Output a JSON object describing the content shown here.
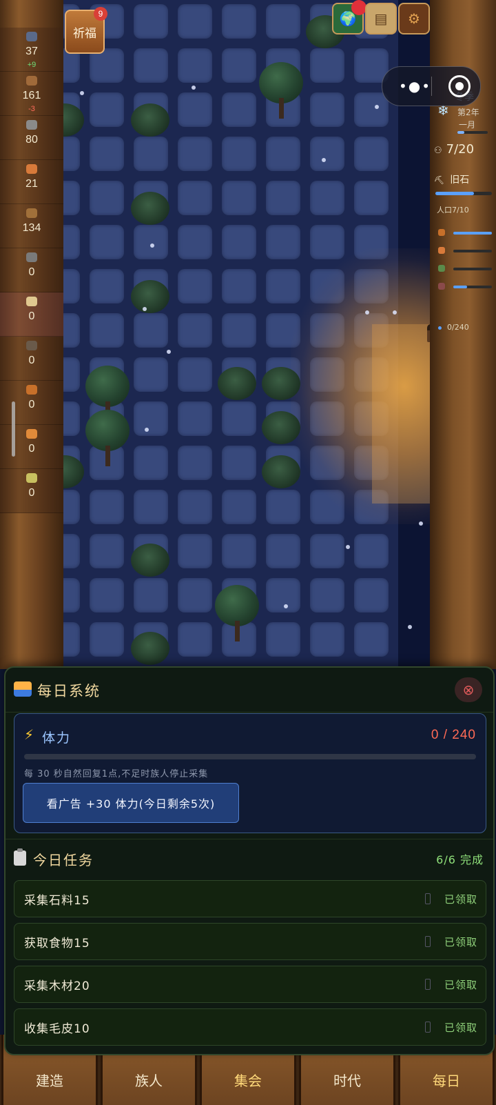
{
  "top": {
    "pray_label": "祈福",
    "pray_badge": "9"
  },
  "resources": [
    {
      "value": "37",
      "delta": "+9",
      "delta_type": "pos",
      "color": "#5a6a8a"
    },
    {
      "value": "161",
      "delta": "-3",
      "delta_type": "neg",
      "color": "#a06a3a"
    },
    {
      "value": "80",
      "delta": "",
      "delta_type": "",
      "color": "#8a8a8a"
    },
    {
      "value": "21",
      "delta": "",
      "delta_type": "",
      "color": "#d87a3a"
    },
    {
      "value": "134",
      "delta": "",
      "delta_type": "",
      "color": "#a0703a"
    },
    {
      "value": "0",
      "delta": "",
      "delta_type": "",
      "color": "#7a7a7a"
    },
    {
      "value": "0",
      "delta": "",
      "delta_type": "",
      "color": "#e0c890"
    },
    {
      "value": "0",
      "delta": "",
      "delta_type": "",
      "color": "#6a5a4a"
    },
    {
      "value": "0",
      "delta": "",
      "delta_type": "",
      "color": "#c8702a"
    },
    {
      "value": "0",
      "delta": "",
      "delta_type": "",
      "color": "#e08a3a"
    },
    {
      "value": "0",
      "delta": "",
      "delta_type": "",
      "color": "#c8c060"
    }
  ],
  "season": {
    "name": "冬季",
    "year": "第2年",
    "month": "一月",
    "progress": 0.22
  },
  "population": {
    "value": "7/20"
  },
  "era": {
    "name": "旧石",
    "progress": 0.68,
    "pop_cap": "人口7/10"
  },
  "mini_bars": [
    {
      "color": "#c8702a",
      "progress": 1.0
    },
    {
      "color": "#d87a3a",
      "progress": 0.0
    },
    {
      "color": "#5a8a4a",
      "progress": 0.0
    },
    {
      "color": "#8a4a4a",
      "progress": 0.35
    }
  ],
  "mini_stamina": "0/240",
  "nav": [
    {
      "label": "建造"
    },
    {
      "label": "族人"
    },
    {
      "label": "集会"
    },
    {
      "label": "时代"
    },
    {
      "label": "每日"
    }
  ],
  "daily": {
    "title": "每日系统",
    "close_icon": "⊗",
    "stamina": {
      "label": "体力",
      "value": "0 / 240",
      "current": 0,
      "max": 240,
      "hint": "每 30 秒自然回复1点,不足时族人停止采集",
      "ad_button": "看广告 +30 体力(今日剩余5次)"
    },
    "tasks_title": "今日任务",
    "tasks_count": "6/6 完成",
    "tasks": [
      {
        "name": "采集石料15",
        "state": "已领取"
      },
      {
        "name": "获取食物15",
        "state": "已领取"
      },
      {
        "name": "采集木材20",
        "state": "已领取"
      },
      {
        "name": "收集毛皮10",
        "state": "已领取"
      }
    ]
  }
}
